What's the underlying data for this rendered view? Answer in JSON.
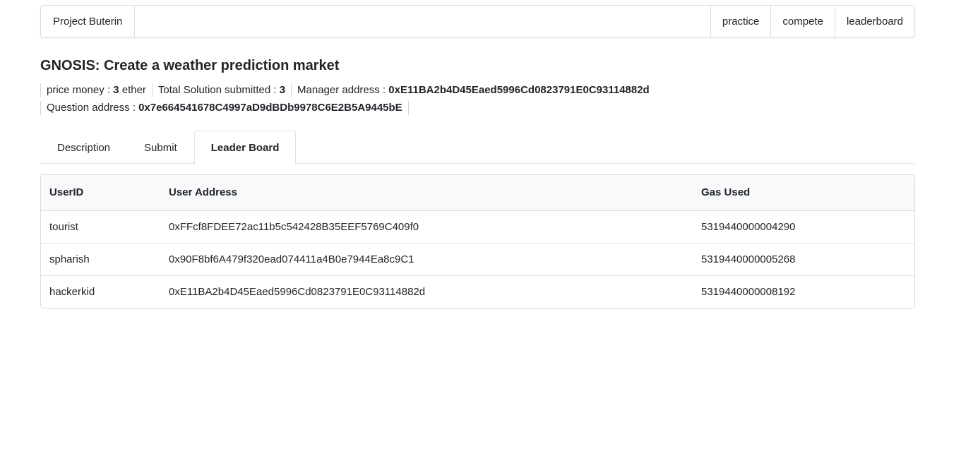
{
  "navbar": {
    "brand": "Project Buterin",
    "items": [
      "practice",
      "compete",
      "leaderboard"
    ]
  },
  "problem": {
    "title": "GNOSIS: Create a weather prediction market",
    "price_label": "price money : ",
    "price_value": "3",
    "price_unit": " ether",
    "solutions_label": "Total Solution submitted : ",
    "solutions_value": "3",
    "manager_label": "Manager address : ",
    "manager_value": "0xE11BA2b4D45Eaed5996Cd0823791E0C93114882d",
    "question_label": "Question address : ",
    "question_value": "0x7e664541678C4997aD9dBDb9978C6E2B5A9445bE"
  },
  "tabs": [
    {
      "label": "Description",
      "active": false
    },
    {
      "label": "Submit",
      "active": false
    },
    {
      "label": "Leader Board",
      "active": true
    }
  ],
  "leaderboard": {
    "headers": [
      "UserID",
      "User Address",
      "Gas Used"
    ],
    "rows": [
      [
        "tourist",
        "0xFFcf8FDEE72ac11b5c542428B35EEF5769C409f0",
        "5319440000004290"
      ],
      [
        "spharish",
        "0x90F8bf6A479f320ead074411a4B0e7944Ea8c9C1",
        "5319440000005268"
      ],
      [
        "hackerkid",
        "0xE11BA2b4D45Eaed5996Cd0823791E0C93114882d",
        "5319440000008192"
      ]
    ]
  }
}
